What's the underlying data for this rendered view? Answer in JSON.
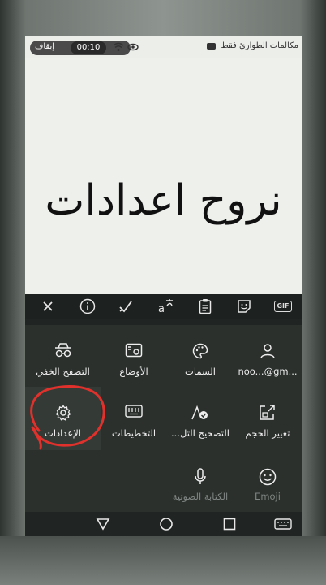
{
  "statusbar": {
    "stop_label": "إيقاف",
    "timer": "00:10",
    "carrier": "مكالمات الطوارئ فقط"
  },
  "overlay": {
    "title": "نروح اعدادات"
  },
  "toolbar": {
    "items": [
      {
        "icon": "close-icon",
        "glyph": "✕"
      },
      {
        "icon": "info-icon",
        "glyph": "i"
      },
      {
        "icon": "check-icon",
        "glyph": "✓"
      },
      {
        "icon": "translate-icon",
        "glyph": "a"
      },
      {
        "icon": "clipboard-icon",
        "glyph": "▤"
      },
      {
        "icon": "sticker-icon",
        "glyph": "☺"
      },
      {
        "icon": "gif-icon",
        "glyph": "GIF"
      }
    ],
    "gif_label": "GIF"
  },
  "keyboard_menu": {
    "row1": [
      {
        "label": "التصفح الخفي",
        "icon": "incognito-icon"
      },
      {
        "label": "الأوضاع",
        "icon": "modes-icon"
      },
      {
        "label": "السمات",
        "icon": "palette-icon"
      },
      {
        "label": "noo...@gm...",
        "icon": "account-icon"
      }
    ],
    "row2": [
      {
        "label": "الإعدادات",
        "icon": "settings-icon"
      },
      {
        "label": "التخطيطات",
        "icon": "keyboard-icon"
      },
      {
        "label": "التصحيح التل...",
        "icon": "autocorrect-icon"
      },
      {
        "label": "تغيير الحجم",
        "icon": "resize-icon"
      }
    ],
    "row3": [
      {
        "label": "الكتابة الصوتية",
        "icon": "mic-icon"
      },
      {
        "label": "Emoji",
        "icon": "emoji-icon"
      }
    ]
  },
  "colors": {
    "keyboard_bg": "#202422",
    "tile_bg": "#2b302d",
    "scribble": "#e0312c"
  }
}
